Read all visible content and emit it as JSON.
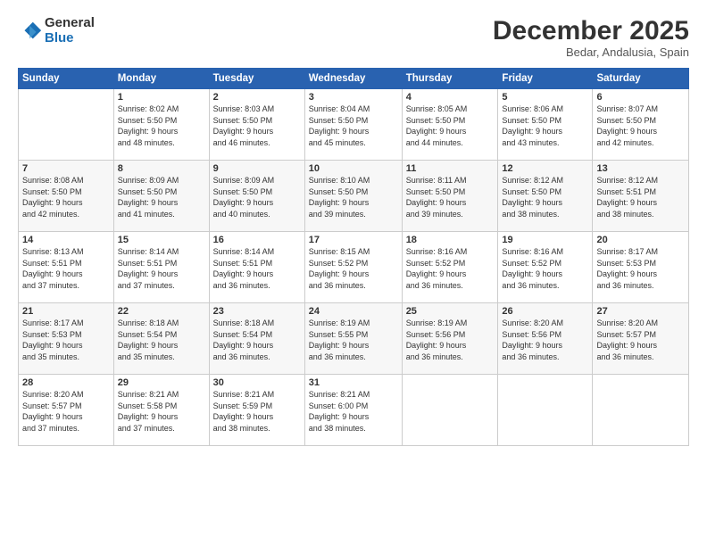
{
  "logo": {
    "general": "General",
    "blue": "Blue"
  },
  "header": {
    "month": "December 2025",
    "location": "Bedar, Andalusia, Spain"
  },
  "weekdays": [
    "Sunday",
    "Monday",
    "Tuesday",
    "Wednesday",
    "Thursday",
    "Friday",
    "Saturday"
  ],
  "weeks": [
    [
      {
        "day": "",
        "info": ""
      },
      {
        "day": "1",
        "info": "Sunrise: 8:02 AM\nSunset: 5:50 PM\nDaylight: 9 hours\nand 48 minutes."
      },
      {
        "day": "2",
        "info": "Sunrise: 8:03 AM\nSunset: 5:50 PM\nDaylight: 9 hours\nand 46 minutes."
      },
      {
        "day": "3",
        "info": "Sunrise: 8:04 AM\nSunset: 5:50 PM\nDaylight: 9 hours\nand 45 minutes."
      },
      {
        "day": "4",
        "info": "Sunrise: 8:05 AM\nSunset: 5:50 PM\nDaylight: 9 hours\nand 44 minutes."
      },
      {
        "day": "5",
        "info": "Sunrise: 8:06 AM\nSunset: 5:50 PM\nDaylight: 9 hours\nand 43 minutes."
      },
      {
        "day": "6",
        "info": "Sunrise: 8:07 AM\nSunset: 5:50 PM\nDaylight: 9 hours\nand 42 minutes."
      }
    ],
    [
      {
        "day": "7",
        "info": "Sunrise: 8:08 AM\nSunset: 5:50 PM\nDaylight: 9 hours\nand 42 minutes."
      },
      {
        "day": "8",
        "info": "Sunrise: 8:09 AM\nSunset: 5:50 PM\nDaylight: 9 hours\nand 41 minutes."
      },
      {
        "day": "9",
        "info": "Sunrise: 8:09 AM\nSunset: 5:50 PM\nDaylight: 9 hours\nand 40 minutes."
      },
      {
        "day": "10",
        "info": "Sunrise: 8:10 AM\nSunset: 5:50 PM\nDaylight: 9 hours\nand 39 minutes."
      },
      {
        "day": "11",
        "info": "Sunrise: 8:11 AM\nSunset: 5:50 PM\nDaylight: 9 hours\nand 39 minutes."
      },
      {
        "day": "12",
        "info": "Sunrise: 8:12 AM\nSunset: 5:50 PM\nDaylight: 9 hours\nand 38 minutes."
      },
      {
        "day": "13",
        "info": "Sunrise: 8:12 AM\nSunset: 5:51 PM\nDaylight: 9 hours\nand 38 minutes."
      }
    ],
    [
      {
        "day": "14",
        "info": "Sunrise: 8:13 AM\nSunset: 5:51 PM\nDaylight: 9 hours\nand 37 minutes."
      },
      {
        "day": "15",
        "info": "Sunrise: 8:14 AM\nSunset: 5:51 PM\nDaylight: 9 hours\nand 37 minutes."
      },
      {
        "day": "16",
        "info": "Sunrise: 8:14 AM\nSunset: 5:51 PM\nDaylight: 9 hours\nand 36 minutes."
      },
      {
        "day": "17",
        "info": "Sunrise: 8:15 AM\nSunset: 5:52 PM\nDaylight: 9 hours\nand 36 minutes."
      },
      {
        "day": "18",
        "info": "Sunrise: 8:16 AM\nSunset: 5:52 PM\nDaylight: 9 hours\nand 36 minutes."
      },
      {
        "day": "19",
        "info": "Sunrise: 8:16 AM\nSunset: 5:52 PM\nDaylight: 9 hours\nand 36 minutes."
      },
      {
        "day": "20",
        "info": "Sunrise: 8:17 AM\nSunset: 5:53 PM\nDaylight: 9 hours\nand 36 minutes."
      }
    ],
    [
      {
        "day": "21",
        "info": "Sunrise: 8:17 AM\nSunset: 5:53 PM\nDaylight: 9 hours\nand 35 minutes."
      },
      {
        "day": "22",
        "info": "Sunrise: 8:18 AM\nSunset: 5:54 PM\nDaylight: 9 hours\nand 35 minutes."
      },
      {
        "day": "23",
        "info": "Sunrise: 8:18 AM\nSunset: 5:54 PM\nDaylight: 9 hours\nand 36 minutes."
      },
      {
        "day": "24",
        "info": "Sunrise: 8:19 AM\nSunset: 5:55 PM\nDaylight: 9 hours\nand 36 minutes."
      },
      {
        "day": "25",
        "info": "Sunrise: 8:19 AM\nSunset: 5:56 PM\nDaylight: 9 hours\nand 36 minutes."
      },
      {
        "day": "26",
        "info": "Sunrise: 8:20 AM\nSunset: 5:56 PM\nDaylight: 9 hours\nand 36 minutes."
      },
      {
        "day": "27",
        "info": "Sunrise: 8:20 AM\nSunset: 5:57 PM\nDaylight: 9 hours\nand 36 minutes."
      }
    ],
    [
      {
        "day": "28",
        "info": "Sunrise: 8:20 AM\nSunset: 5:57 PM\nDaylight: 9 hours\nand 37 minutes."
      },
      {
        "day": "29",
        "info": "Sunrise: 8:21 AM\nSunset: 5:58 PM\nDaylight: 9 hours\nand 37 minutes."
      },
      {
        "day": "30",
        "info": "Sunrise: 8:21 AM\nSunset: 5:59 PM\nDaylight: 9 hours\nand 38 minutes."
      },
      {
        "day": "31",
        "info": "Sunrise: 8:21 AM\nSunset: 6:00 PM\nDaylight: 9 hours\nand 38 minutes."
      },
      {
        "day": "",
        "info": ""
      },
      {
        "day": "",
        "info": ""
      },
      {
        "day": "",
        "info": ""
      }
    ]
  ]
}
